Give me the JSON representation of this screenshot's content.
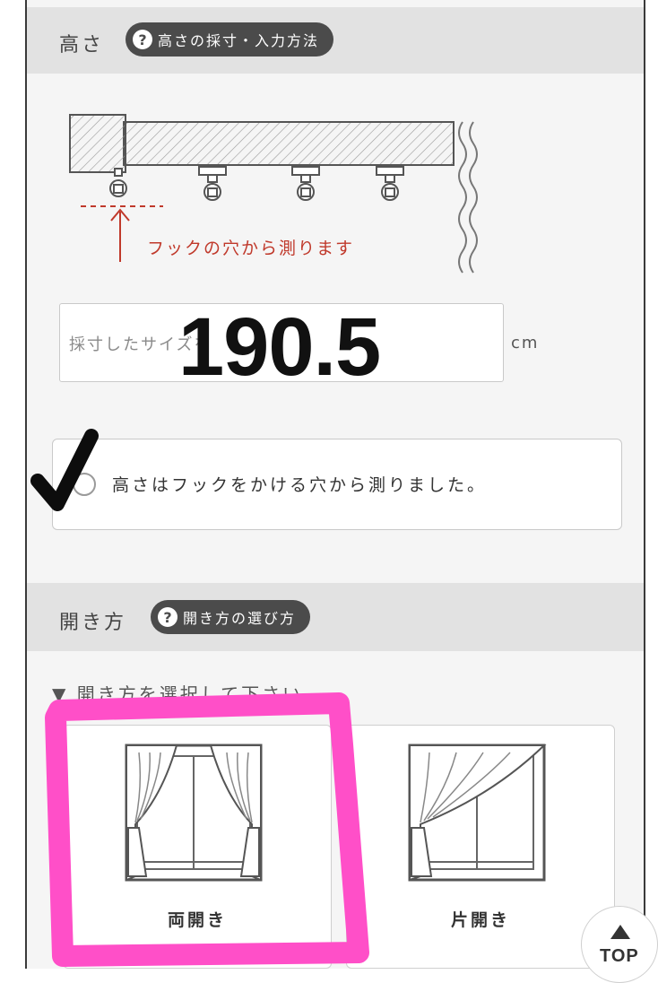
{
  "height_section": {
    "title": "高さ",
    "help_label": "高さの採寸・入力方法",
    "diagram_note": "フックの穴から測ります",
    "input": {
      "placeholder": "採寸したサイズを",
      "value": "190.5",
      "unit": "cm"
    },
    "confirm_label": "高さはフックをかける穴から測りました。"
  },
  "opening_section": {
    "title": "開き方",
    "help_label": "開き方の選び方",
    "prompt": "▼ 開き方を選択して下さい",
    "options": [
      {
        "label": "両開き"
      },
      {
        "label": "片開き"
      }
    ]
  },
  "top_button": {
    "label": "TOP"
  },
  "colors": {
    "header_bg": "#e2e2e2",
    "pill_bg": "#4b4b4b",
    "note_red": "#c0392b",
    "highlight_pink": "#ff4fc8"
  }
}
